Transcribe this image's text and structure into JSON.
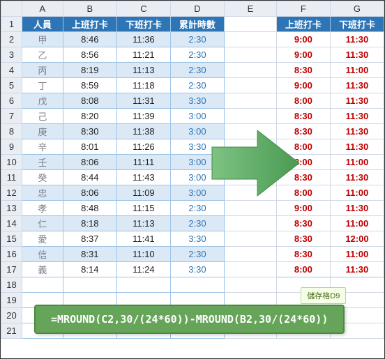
{
  "cols": [
    "A",
    "B",
    "C",
    "D",
    "E",
    "F",
    "G"
  ],
  "rownums": [
    "1",
    "2",
    "3",
    "4",
    "5",
    "6",
    "7",
    "8",
    "9",
    "10",
    "11",
    "12",
    "13",
    "14",
    "15",
    "16",
    "17",
    "18",
    "19",
    "20",
    "21"
  ],
  "header_left": {
    "A": "人員",
    "B": "上班打卡",
    "C": "下班打卡",
    "D": "累計時數"
  },
  "header_right": {
    "F": "上班打卡",
    "G": "下班打卡"
  },
  "rows": [
    {
      "A": "甲",
      "B": "8:46",
      "C": "11:36",
      "D": "2:30",
      "F": "9:00",
      "G": "11:30"
    },
    {
      "A": "乙",
      "B": "8:56",
      "C": "11:21",
      "D": "2:30",
      "F": "9:00",
      "G": "11:30"
    },
    {
      "A": "丙",
      "B": "8:19",
      "C": "11:13",
      "D": "2:30",
      "F": "8:30",
      "G": "11:00"
    },
    {
      "A": "丁",
      "B": "8:59",
      "C": "11:18",
      "D": "2:30",
      "F": "9:00",
      "G": "11:30"
    },
    {
      "A": "戊",
      "B": "8:08",
      "C": "11:31",
      "D": "3:30",
      "F": "8:00",
      "G": "11:30"
    },
    {
      "A": "己",
      "B": "8:20",
      "C": "11:39",
      "D": "3:00",
      "F": "8:30",
      "G": "11:30"
    },
    {
      "A": "庚",
      "B": "8:30",
      "C": "11:38",
      "D": "3:00",
      "F": "8:30",
      "G": "11:30"
    },
    {
      "A": "辛",
      "B": "8:01",
      "C": "11:26",
      "D": "3:30",
      "F": "8:00",
      "G": "11:30"
    },
    {
      "A": "壬",
      "B": "8:06",
      "C": "11:11",
      "D": "3:00",
      "F": "8:00",
      "G": "11:00"
    },
    {
      "A": "癸",
      "B": "8:44",
      "C": "11:43",
      "D": "3:00",
      "F": "8:30",
      "G": "11:30"
    },
    {
      "A": "忠",
      "B": "8:06",
      "C": "11:09",
      "D": "3:00",
      "F": "8:00",
      "G": "11:00"
    },
    {
      "A": "孝",
      "B": "8:48",
      "C": "11:15",
      "D": "2:30",
      "F": "9:00",
      "G": "11:30"
    },
    {
      "A": "仁",
      "B": "8:18",
      "C": "11:13",
      "D": "2:30",
      "F": "8:30",
      "G": "11:00"
    },
    {
      "A": "愛",
      "B": "8:37",
      "C": "11:41",
      "D": "3:30",
      "F": "8:30",
      "G": "12:00"
    },
    {
      "A": "信",
      "B": "8:31",
      "C": "11:10",
      "D": "2:30",
      "F": "8:30",
      "G": "11:00"
    },
    {
      "A": "義",
      "B": "8:14",
      "C": "11:24",
      "D": "3:30",
      "F": "8:00",
      "G": "11:30"
    }
  ],
  "colwidths": {
    "row": 28,
    "A": 55,
    "B": 72,
    "C": 72,
    "D": 72,
    "E": 70,
    "F": 72,
    "G": 72
  },
  "callout_label": "儲存格D9",
  "formula": "=MROUND(C2,30/(24*60))-MROUND(B2,30/(24*60))",
  "arrow_color": "#58a05a"
}
